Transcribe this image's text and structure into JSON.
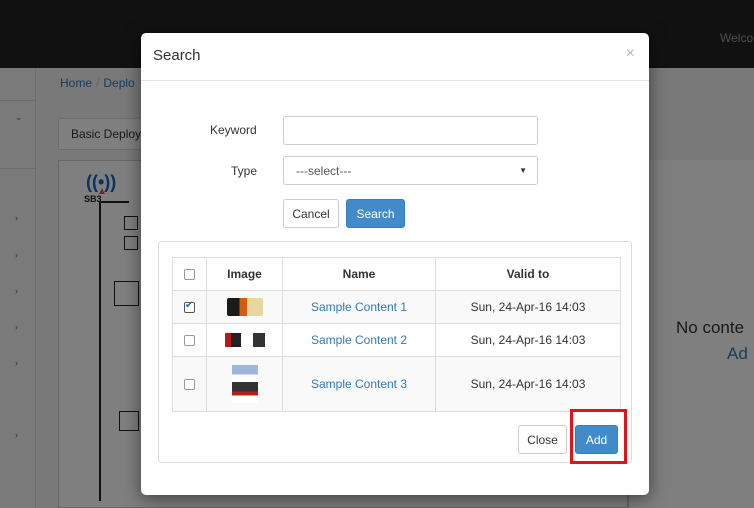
{
  "topbar": {
    "welcome_text": "Welco"
  },
  "breadcrumb": {
    "home": "Home",
    "current": "Deplo"
  },
  "tabs": {
    "basic_deploy": "Basic Deploy"
  },
  "floorplan": {
    "label": "SB3"
  },
  "right_panel": {
    "message": "No conte",
    "link": "Ad"
  },
  "modal": {
    "title": "Search",
    "close_symbol": "×",
    "keyword_label": "Keyword",
    "keyword_value": "",
    "type_label": "Type",
    "type_selected": "---select---",
    "cancel_label": "Cancel",
    "search_label": "Search",
    "table": {
      "headers": [
        "Image",
        "Name",
        "Valid to"
      ],
      "rows": [
        {
          "checked": true,
          "name": "Sample Content 1",
          "valid_to": "Sun, 24-Apr-16 14:03"
        },
        {
          "checked": false,
          "name": "Sample Content 2",
          "valid_to": "Sun, 24-Apr-16 14:03"
        },
        {
          "checked": false,
          "name": "Sample Content 3",
          "valid_to": "Sun, 24-Apr-16 14:03"
        }
      ]
    },
    "footer": {
      "close_label": "Close",
      "add_label": "Add"
    }
  },
  "colors": {
    "primary": "#428bca",
    "highlight": "#e0151b",
    "link": "#337ab7"
  }
}
